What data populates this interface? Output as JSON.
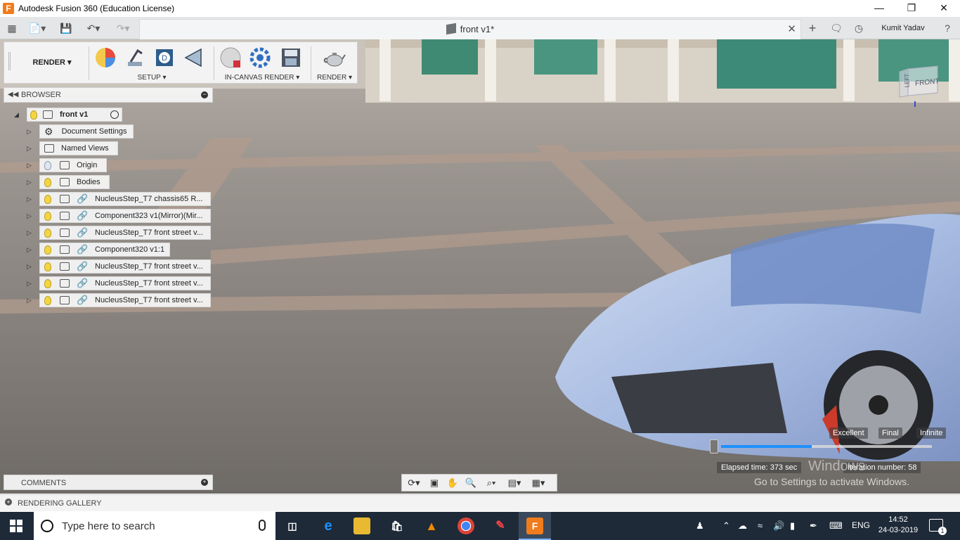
{
  "window": {
    "title": "Autodesk Fusion 360 (Education License)",
    "controls": [
      "minimize-icon",
      "maximize-icon",
      "close-icon"
    ]
  },
  "qat": {
    "doc_tab_title": "front v1*",
    "user_name": "Kumit Yadav"
  },
  "toolbar": {
    "mode_label": "RENDER ▾",
    "groups": [
      {
        "label": "SETUP ▾",
        "icons": [
          "appearance-icon",
          "scene-settings-icon",
          "decal-icon",
          "texture-map-icon"
        ]
      },
      {
        "label": "IN-CANVAS RENDER ▾",
        "icons": [
          "in-canvas-render-icon",
          "render-settings-icon",
          "capture-image-icon"
        ]
      },
      {
        "label": "RENDER ▾",
        "icons": [
          "render-teapot-icon"
        ]
      }
    ]
  },
  "browser": {
    "header_label": "BROWSER",
    "root_label": "front v1",
    "items": [
      {
        "label": "Document Settings",
        "bulb": null,
        "icon": "gear"
      },
      {
        "label": "Named Views",
        "bulb": null,
        "icon": "folder"
      },
      {
        "label": "Origin",
        "bulb": "off",
        "icon": "folder"
      },
      {
        "label": "Bodies",
        "bulb": "on",
        "icon": "folder"
      },
      {
        "label": "NucleusStep_T7 chassis65 R...",
        "bulb": "on",
        "icon": "component-link"
      },
      {
        "label": "Component323 v1(Mirror)(Mir...",
        "bulb": "on",
        "icon": "component-link"
      },
      {
        "label": "NucleusStep_T7 front street v...",
        "bulb": "on",
        "icon": "component-link"
      },
      {
        "label": "Component320 v1:1",
        "bulb": "on",
        "icon": "component-link"
      },
      {
        "label": "NucleusStep_T7 front street v...",
        "bulb": "on",
        "icon": "component-link"
      },
      {
        "label": "NucleusStep_T7 front street v...",
        "bulb": "on",
        "icon": "component-link"
      },
      {
        "label": "NucleusStep_T7 front street v...",
        "bulb": "on",
        "icon": "component-link"
      }
    ]
  },
  "comments": {
    "label": "COMMENTS"
  },
  "gallery": {
    "label": "RENDERING GALLERY"
  },
  "viewcube": {
    "face_label": "FRONT",
    "side_label": "LEFT"
  },
  "render_progress": {
    "quality_labels": [
      "Excellent",
      "Final",
      "Infinite"
    ],
    "progress_fraction": 0.43,
    "elapsed": "Elapsed time: 373 sec",
    "iteration": "Iteration number: 58"
  },
  "watermark": {
    "line1": "Windows",
    "line2": "Go to Settings to activate Windows."
  },
  "taskbar": {
    "search_placeholder": "Type here to search",
    "apps": [
      "task-view-icon",
      "edge-icon",
      "file-explorer-icon",
      "store-icon",
      "vlc-icon",
      "chrome-icon",
      "sketch-icon",
      "fusion-icon"
    ],
    "language": "ENG",
    "time": "14:52",
    "date": "24-03-2019",
    "notification_count": "1"
  },
  "colors": {
    "accent": "#1e90ff",
    "fusion_orange": "#f07c1c",
    "taskbar": "#1e2a38"
  }
}
